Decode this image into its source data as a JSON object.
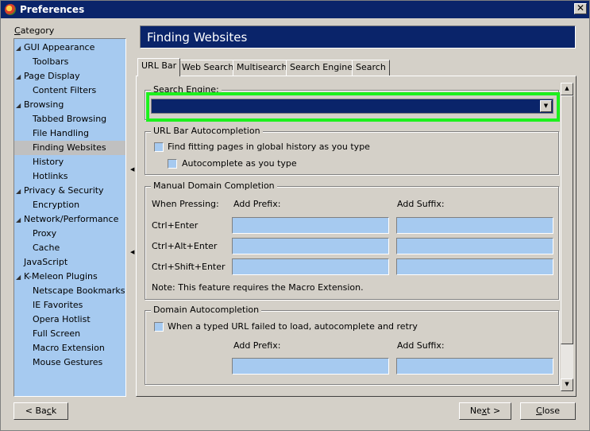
{
  "window": {
    "title": "Preferences",
    "close_glyph": "✕"
  },
  "sidebar": {
    "label_accel": "C",
    "label_rest": "ategory",
    "items": [
      {
        "label": "GUI Appearance",
        "level": 0,
        "toggle": "◢"
      },
      {
        "label": "Toolbars",
        "level": 1,
        "toggle": ""
      },
      {
        "label": "Page Display",
        "level": 0,
        "toggle": "◢"
      },
      {
        "label": "Content Filters",
        "level": 1,
        "toggle": ""
      },
      {
        "label": "Browsing",
        "level": 0,
        "toggle": "◢"
      },
      {
        "label": "Tabbed Browsing",
        "level": 1,
        "toggle": ""
      },
      {
        "label": "File Handling",
        "level": 1,
        "toggle": ""
      },
      {
        "label": "Finding Websites",
        "level": 1,
        "toggle": "",
        "selected": true
      },
      {
        "label": "History",
        "level": 1,
        "toggle": ""
      },
      {
        "label": "Hotlinks",
        "level": 1,
        "toggle": ""
      },
      {
        "label": "Privacy & Security",
        "level": 0,
        "toggle": "◢"
      },
      {
        "label": "Encryption",
        "level": 1,
        "toggle": ""
      },
      {
        "label": "Network/Performance",
        "level": 0,
        "toggle": "◢"
      },
      {
        "label": "Proxy",
        "level": 1,
        "toggle": ""
      },
      {
        "label": "Cache",
        "level": 1,
        "toggle": ""
      },
      {
        "label": "JavaScript",
        "level": 0,
        "toggle": ""
      },
      {
        "label": "K-Meleon Plugins",
        "level": 0,
        "toggle": "◢"
      },
      {
        "label": "Netscape Bookmarks",
        "level": 1,
        "toggle": ""
      },
      {
        "label": "IE Favorites",
        "level": 1,
        "toggle": ""
      },
      {
        "label": "Opera Hotlist",
        "level": 1,
        "toggle": ""
      },
      {
        "label": "Full Screen",
        "level": 1,
        "toggle": ""
      },
      {
        "label": "Macro Extension",
        "level": 1,
        "toggle": ""
      },
      {
        "label": "Mouse Gestures",
        "level": 1,
        "toggle": ""
      }
    ]
  },
  "main": {
    "header": "Finding Websites",
    "tabs": [
      "URL Bar",
      "Web Search",
      "Multisearch",
      "Search Engines",
      "Search"
    ],
    "search_engine": {
      "legend": "Search Engine:",
      "value": "",
      "arrow": "▼"
    },
    "autocompletion": {
      "legend": "URL Bar Autocompletion",
      "find_pages": "Find fitting pages in global history as you type",
      "autocomplete": "Autocomplete as you type"
    },
    "manual": {
      "legend": "Manual Domain Completion",
      "col_when": "When Pressing:",
      "col_prefix": "Add Prefix:",
      "col_suffix": "Add Suffix:",
      "rows": [
        "Ctrl+Enter",
        "Ctrl+Alt+Enter",
        "Ctrl+Shift+Enter"
      ],
      "note": "Note: This feature requires the Macro Extension."
    },
    "domain": {
      "legend": "Domain Autocompletion",
      "retry": "When a typed URL failed to load, autocomplete and retry",
      "col_prefix": "Add Prefix:",
      "col_suffix": "Add Suffix:"
    },
    "scroll": {
      "up": "▲",
      "down": "▼"
    },
    "splitter": {
      "left": "◀"
    }
  },
  "footer": {
    "back_pre": "< Ba",
    "back_accel": "c",
    "back_post": "k",
    "next_pre": "Ne",
    "next_accel": "x",
    "next_post": "t >",
    "close_accel": "C",
    "close_post": "lose"
  }
}
